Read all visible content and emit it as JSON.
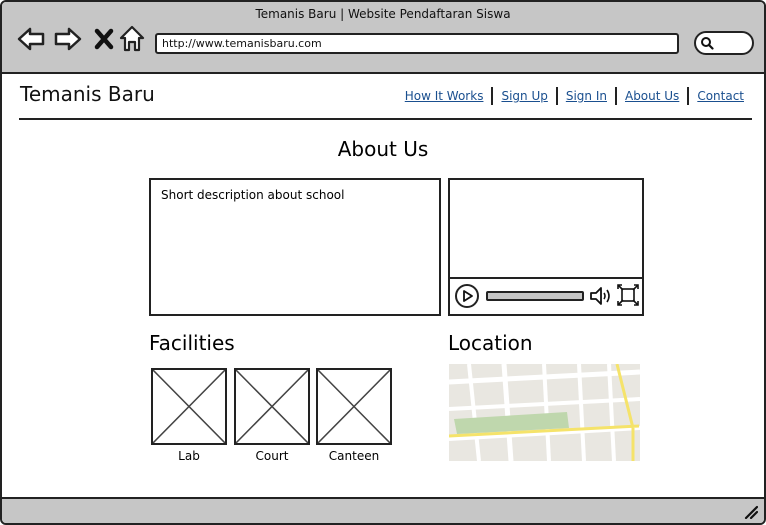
{
  "window": {
    "title": "Temanis Baru | Website Pendaftaran Siswa"
  },
  "browser": {
    "url": "http://www.temanisbaru.com",
    "nav_icons": [
      "back-arrow-icon",
      "forward-arrow-icon",
      "close-x-icon",
      "home-icon"
    ],
    "search_icon": "search-icon"
  },
  "site": {
    "title": "Temanis Baru"
  },
  "nav": {
    "items": [
      {
        "label": "How It Works"
      },
      {
        "label": "Sign Up"
      },
      {
        "label": "Sign In"
      },
      {
        "label": "About Us"
      },
      {
        "label": "Contact"
      }
    ]
  },
  "main": {
    "heading": "About Us",
    "description": "Short description about school",
    "video_icons": [
      "play-icon",
      "volume-icon",
      "fullscreen-icon"
    ]
  },
  "facilities": {
    "title": "Facilities",
    "items": [
      {
        "label": "Lab"
      },
      {
        "label": "Court"
      },
      {
        "label": "Canteen"
      }
    ]
  },
  "location": {
    "title": "Location"
  },
  "colors": {
    "chrome": "#c6c6c6",
    "link": "#1a4f8f",
    "map_bg": "#e9e7e1",
    "map_road": "#ffffff",
    "map_highway": "#f5e36a",
    "map_park": "#bfd7ad"
  }
}
